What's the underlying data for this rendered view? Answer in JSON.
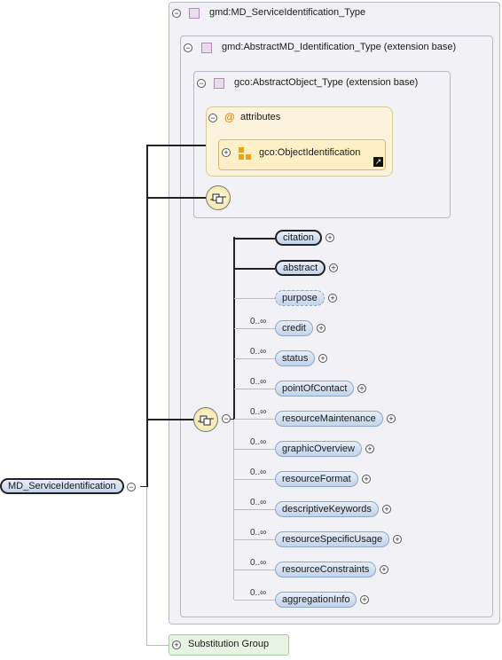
{
  "root": {
    "label": "MD_ServiceIdentification"
  },
  "types": {
    "service": "gmd:MD_ServiceIdentification_Type",
    "abstract_ident": "gmd:AbstractMD_Identification_Type (extension base)",
    "abstract_object": "gco:AbstractObject_Type (extension base)"
  },
  "attributes": {
    "title": "attributes",
    "group": "gco:ObjectIdentification"
  },
  "elements": [
    {
      "label": "citation",
      "occurrence": ""
    },
    {
      "label": "abstract",
      "occurrence": ""
    },
    {
      "label": "purpose",
      "occurrence": ""
    },
    {
      "label": "credit",
      "occurrence": "0..∞"
    },
    {
      "label": "status",
      "occurrence": "0..∞"
    },
    {
      "label": "pointOfContact",
      "occurrence": "0..∞"
    },
    {
      "label": "resourceMaintenance",
      "occurrence": "0..∞"
    },
    {
      "label": "graphicOverview",
      "occurrence": "0..∞"
    },
    {
      "label": "resourceFormat",
      "occurrence": "0..∞"
    },
    {
      "label": "descriptiveKeywords",
      "occurrence": "0..∞"
    },
    {
      "label": "resourceSpecificUsage",
      "occurrence": "0..∞"
    },
    {
      "label": "resourceConstraints",
      "occurrence": "0..∞"
    },
    {
      "label": "aggregationInfo",
      "occurrence": "0..∞"
    }
  ],
  "substitution": {
    "label": "Substitution Group"
  },
  "glyphs": {
    "collapse": "−",
    "expand": "+",
    "at": "@"
  }
}
